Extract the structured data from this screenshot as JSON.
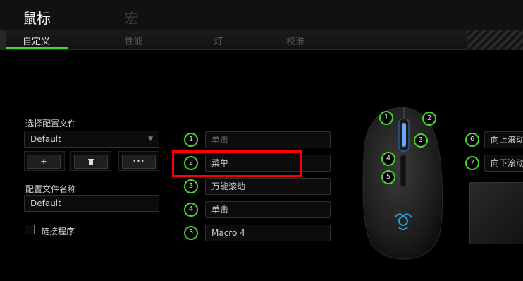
{
  "header": {
    "title": "鼠标",
    "macro_label": "宏"
  },
  "tabs": [
    {
      "label": "自定义",
      "active": true
    },
    {
      "label": "性能",
      "active": false
    },
    {
      "label": "灯",
      "active": false
    },
    {
      "label": "校准",
      "active": false
    }
  ],
  "profile": {
    "select_label": "选择配置文件",
    "selected": "Default",
    "buttons": {
      "add": "+",
      "delete_icon": "trash-icon",
      "more": "•••"
    },
    "name_label": "配置文件名称",
    "name_value": "Default",
    "link_label": "链接程序",
    "link_checked": false
  },
  "assignments": [
    {
      "num": "1",
      "value": "单击"
    },
    {
      "num": "2",
      "value": "菜单"
    },
    {
      "num": "3",
      "value": "万能滚动"
    },
    {
      "num": "4",
      "value": "单击"
    },
    {
      "num": "5",
      "value": "Macro 4"
    }
  ],
  "mouse_callouts": [
    "1",
    "2",
    "3",
    "4",
    "5"
  ],
  "right_assignments": [
    {
      "num": "6",
      "value": "向上滚动"
    },
    {
      "num": "7",
      "value": "向下滚动"
    }
  ],
  "colors": {
    "accent": "#44d62c",
    "highlight": "#ff0000",
    "background": "#000000"
  }
}
